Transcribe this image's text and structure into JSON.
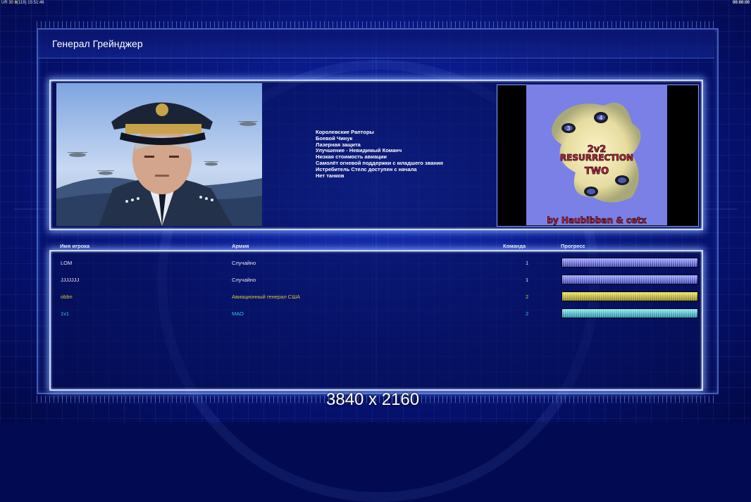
{
  "topbar": {
    "left_prefix": "UR 30",
    "left_highlight": "8",
    "left_paren": "(119)",
    "clock": "15:51:46",
    "right_timer": "00:00:00"
  },
  "general": {
    "title": "Генерал Грейнджер",
    "features": [
      "Королевские Рапторы",
      "Боевой Чинук",
      "Лазерная защита",
      "Улучшение - Невидимый Команч",
      "Низкая стоимость авиации",
      "Самолёт огневой поддержки с младшего звания",
      "Истребитель Стелс доступен с начала",
      "Нет танков"
    ]
  },
  "map_preview": {
    "line1": "2v2",
    "line2": "RESURRECTION",
    "line3": "TWO",
    "credit": "by Haubibban & cetx",
    "start_numbers": [
      "3",
      "4"
    ]
  },
  "players_table": {
    "headers": {
      "name": "Имя игрока",
      "army": "Армия",
      "team": "Команда",
      "progress": "Прогресс"
    },
    "rows": [
      {
        "name": "LOM",
        "army": "Случайно",
        "team": "1",
        "color": "#e6e6f0",
        "bar_top": "#9fa8ff",
        "bar_bot": "#3a40a8",
        "progress": 1.0
      },
      {
        "name": "JJJJJJJ",
        "army": "Случайно",
        "team": "1",
        "color": "#e6e6f0",
        "bar_top": "#9fa8ff",
        "bar_bot": "#3a40a8",
        "progress": 1.0
      },
      {
        "name": "obbn",
        "army": "Авиационный генерал США",
        "team": "2",
        "color": "#d9c832",
        "bar_top": "#f0e66a",
        "bar_bot": "#8a7e12",
        "progress": 1.0
      },
      {
        "name": "1v1",
        "army": "МАО",
        "team": "2",
        "color": "#39c6d9",
        "bar_top": "#8fe8f2",
        "bar_bot": "#1a8a99",
        "progress": 1.0
      }
    ]
  },
  "resolution_label": "3840 x 2160"
}
